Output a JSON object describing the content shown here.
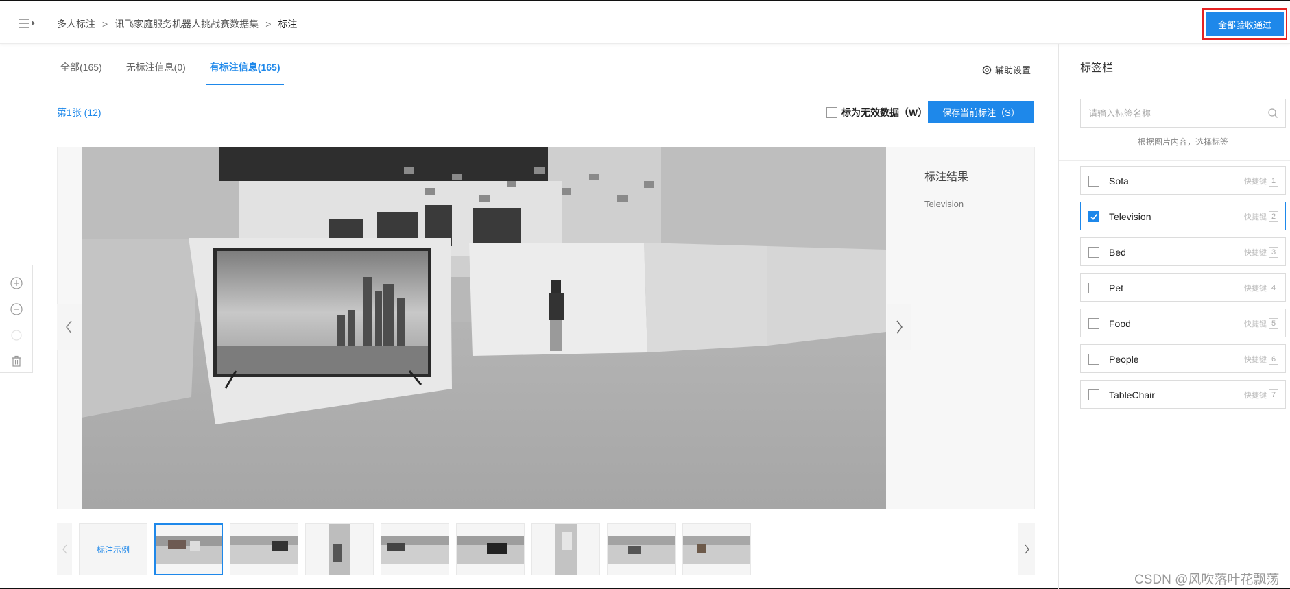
{
  "breadcrumb": {
    "items": [
      "多人标注",
      "讯飞家庭服务机器人挑战赛数据集",
      "标注"
    ]
  },
  "header": {
    "accept_all_label": "全部验收通过"
  },
  "tabs": [
    {
      "label": "全部(165)",
      "active": false
    },
    {
      "label": "无标注信息(0)",
      "active": false
    },
    {
      "label": "有标注信息(165)",
      "active": true
    }
  ],
  "aux_settings_label": "辅助设置",
  "page_indicator": "第1张 (12)",
  "invalid_data": {
    "label": "标为无效数据（W）",
    "checked": false
  },
  "save_button_label": "保存当前标注（S）",
  "annotation_result": {
    "title": "标注结果",
    "items": [
      "Television"
    ]
  },
  "thumbnails": {
    "example_label": "标注示例",
    "count": 8,
    "active_index": 0
  },
  "label_panel": {
    "title": "标签栏",
    "search_placeholder": "请输入标签名称",
    "hint": "根据图片内容，选择标签",
    "shortcut_text": "快捷键",
    "labels": [
      {
        "name": "Sofa",
        "key": "1",
        "checked": false
      },
      {
        "name": "Television",
        "key": "2",
        "checked": true
      },
      {
        "name": "Bed",
        "key": "3",
        "checked": false
      },
      {
        "name": "Pet",
        "key": "4",
        "checked": false
      },
      {
        "name": "Food",
        "key": "5",
        "checked": false
      },
      {
        "name": "People",
        "key": "6",
        "checked": false
      },
      {
        "name": "TableChair",
        "key": "7",
        "checked": false
      }
    ]
  },
  "watermark": "CSDN @风吹落叶花飘荡",
  "colors": {
    "accent": "#1e88ea",
    "highlight_border": "#e52222"
  }
}
